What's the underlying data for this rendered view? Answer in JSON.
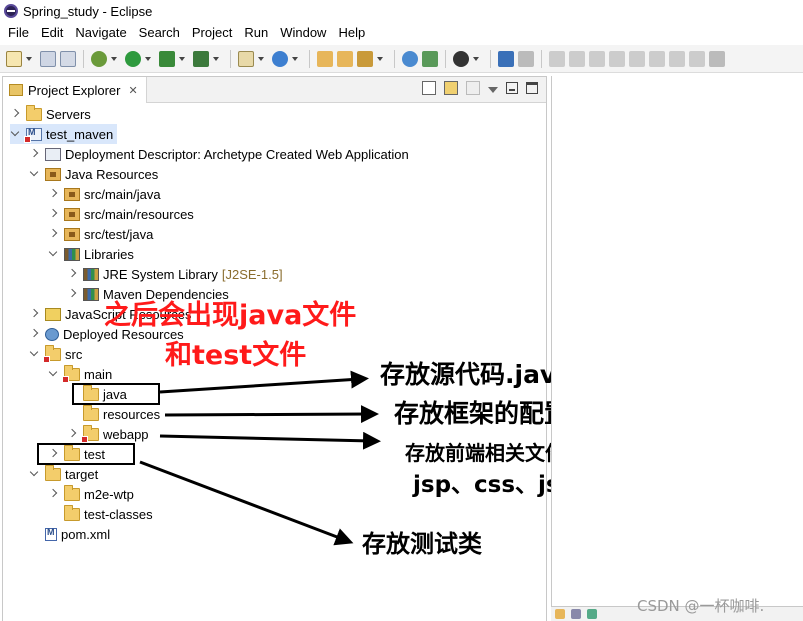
{
  "window": {
    "title": "Spring_study - Eclipse"
  },
  "menu": [
    "File",
    "Edit",
    "Navigate",
    "Search",
    "Project",
    "Run",
    "Window",
    "Help"
  ],
  "explorer": {
    "tab_label": "Project Explorer",
    "close_glyph": "✕"
  },
  "tree": [
    {
      "label": "Servers",
      "icon": "folder-icon",
      "twisty": "closed"
    },
    {
      "label": "test_maven",
      "icon": "maven-project-icon",
      "twisty": "open",
      "selected": true
    },
    {
      "label": "Deployment Descriptor: Archetype Created Web Application",
      "icon": "deployment-descriptor-icon",
      "twisty": "closed"
    },
    {
      "label": "Java Resources",
      "icon": "java-resources-icon",
      "twisty": "open"
    },
    {
      "label": "src/main/java",
      "icon": "package-folder-icon",
      "twisty": "closed"
    },
    {
      "label": "src/main/resources",
      "icon": "package-folder-icon",
      "twisty": "closed"
    },
    {
      "label": "src/test/java",
      "icon": "package-folder-icon",
      "twisty": "closed"
    },
    {
      "label": "Libraries",
      "icon": "library-icon",
      "twisty": "open"
    },
    {
      "label": "JRE System Library",
      "decor": "[J2SE-1.5]",
      "icon": "library-icon",
      "twisty": "closed"
    },
    {
      "label": "Maven Dependencies",
      "icon": "library-icon",
      "twisty": "closed"
    },
    {
      "label": "JavaScript Resources",
      "icon": "javascript-icon",
      "twisty": "closed"
    },
    {
      "label": "Deployed Resources",
      "icon": "web-resources-icon",
      "twisty": "closed"
    },
    {
      "label": "src",
      "icon": "folder-icon",
      "twisty": "open",
      "error": true
    },
    {
      "label": "main",
      "icon": "folder-icon",
      "twisty": "open",
      "error": true
    },
    {
      "label": "java",
      "icon": "folder-icon",
      "twisty": "none"
    },
    {
      "label": "resources",
      "icon": "folder-icon",
      "twisty": "none"
    },
    {
      "label": "webapp",
      "icon": "folder-icon",
      "twisty": "closed",
      "error": true
    },
    {
      "label": "test",
      "icon": "folder-icon",
      "twisty": "closed"
    },
    {
      "label": "target",
      "icon": "folder-icon",
      "twisty": "open"
    },
    {
      "label": "m2e-wtp",
      "icon": "folder-icon",
      "twisty": "closed"
    },
    {
      "label": "test-classes",
      "icon": "folder-icon",
      "twisty": "none"
    },
    {
      "label": "pom.xml",
      "icon": "maven-pom-icon",
      "twisty": "none"
    }
  ],
  "annotations": {
    "red_line1": "之后会出现java文件",
    "red_line2": "和test文件",
    "java_note": "存放源代码.java文件结尾",
    "resources_note": "存放框架的配置文件",
    "webapp_note_line1": "存放前端相关文件，如：",
    "webapp_note_line2": "jsp、css、js、images",
    "test_note": "存放测试类"
  },
  "watermark": "CSDN @一杯咖啡."
}
